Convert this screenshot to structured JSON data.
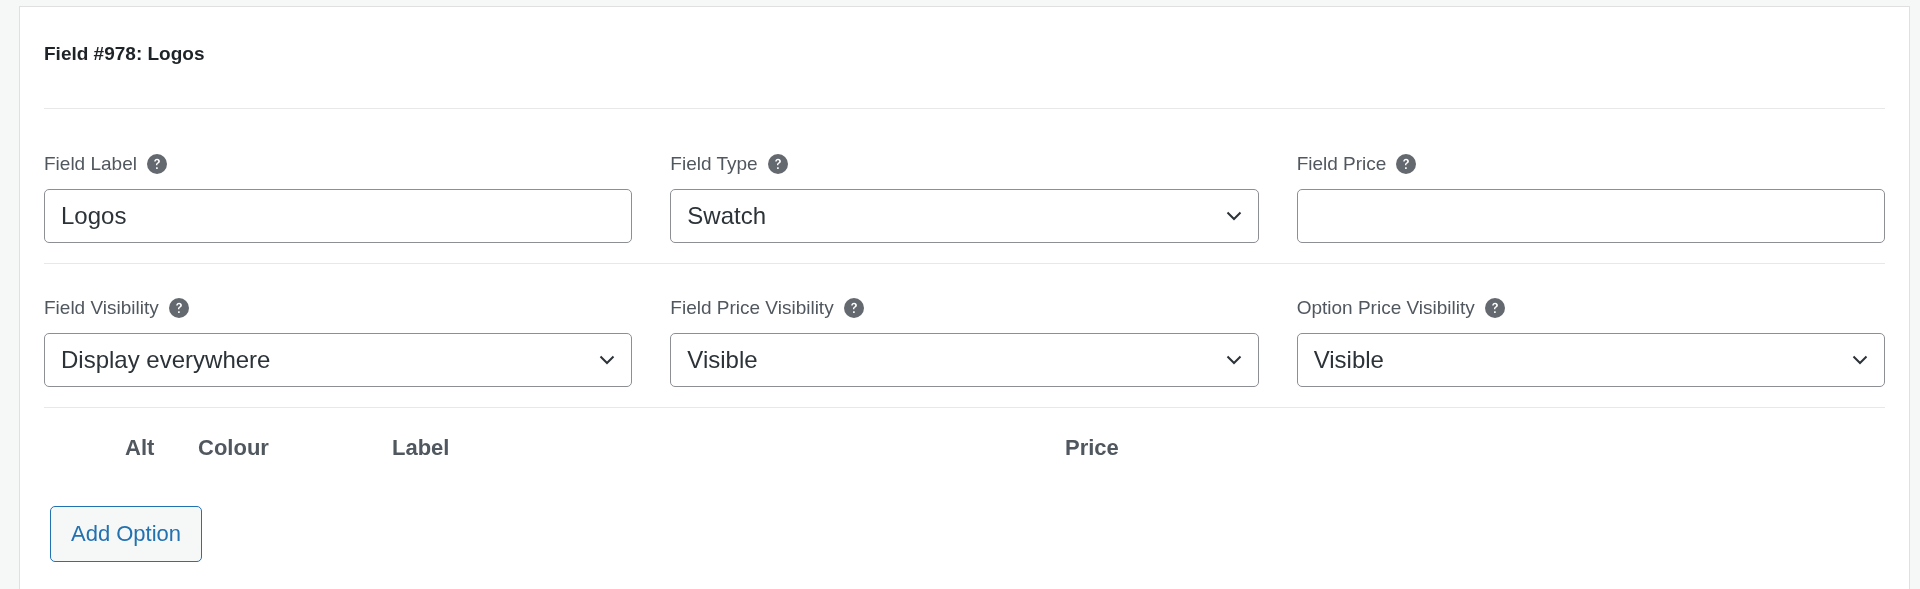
{
  "title": "Field #978: Logos",
  "field_rows": [
    [
      {
        "label": "Field Label",
        "kind": "text",
        "value": "Logos"
      },
      {
        "label": "Field Type",
        "kind": "select",
        "value": "Swatch"
      },
      {
        "label": "Field Price",
        "kind": "text"
      }
    ],
    [
      {
        "label": "Field Visibility",
        "kind": "select",
        "value": "Display everywhere"
      },
      {
        "label": "Field Price Visibility",
        "kind": "select",
        "value": "Visible"
      },
      {
        "label": "Option Price Visibility",
        "kind": "select",
        "value": "Visible"
      }
    ]
  ],
  "options_table": {
    "columns": [
      "Alt",
      "Colour",
      "Label",
      "Price"
    ]
  },
  "add_button": "Add Option"
}
